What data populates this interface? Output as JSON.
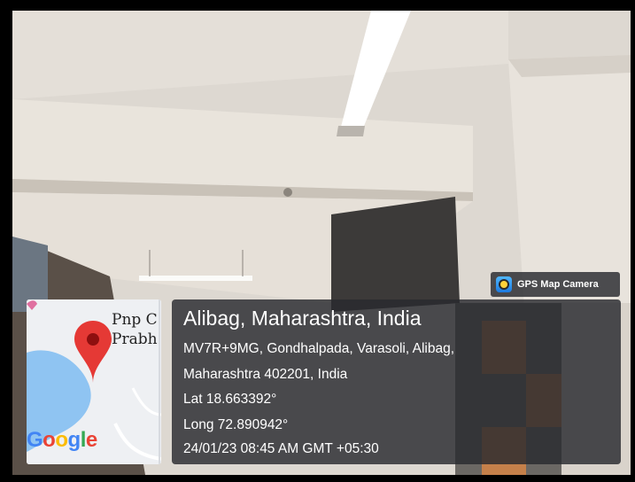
{
  "watermark": {
    "app_name": "GPS Map Camera",
    "icon": "gps-map-camera-icon"
  },
  "location": {
    "title": "Alibag, Maharashtra, India",
    "address_line1": "MV7R+9MG, Gondhalpada, Varasoli, Alibag,",
    "address_line2": "Maharashtra 402201, India",
    "latitude": "Lat 18.663392°",
    "longitude": "Long 72.890942°",
    "timestamp": "24/01/23 08:45 AM GMT +05:30"
  },
  "map": {
    "place_label_line1": "Pnp C",
    "place_label_line2": "Prabh",
    "logo_letters": [
      "G",
      "o",
      "o",
      "g",
      "l",
      "e"
    ],
    "marker": "map-pin-icon",
    "colors": {
      "pin": "#e53935",
      "water": "#8fc4f2",
      "logo_blue": "#4285f4",
      "logo_red": "#ea4335",
      "logo_yellow": "#fbbc05",
      "logo_green": "#34a853"
    }
  }
}
